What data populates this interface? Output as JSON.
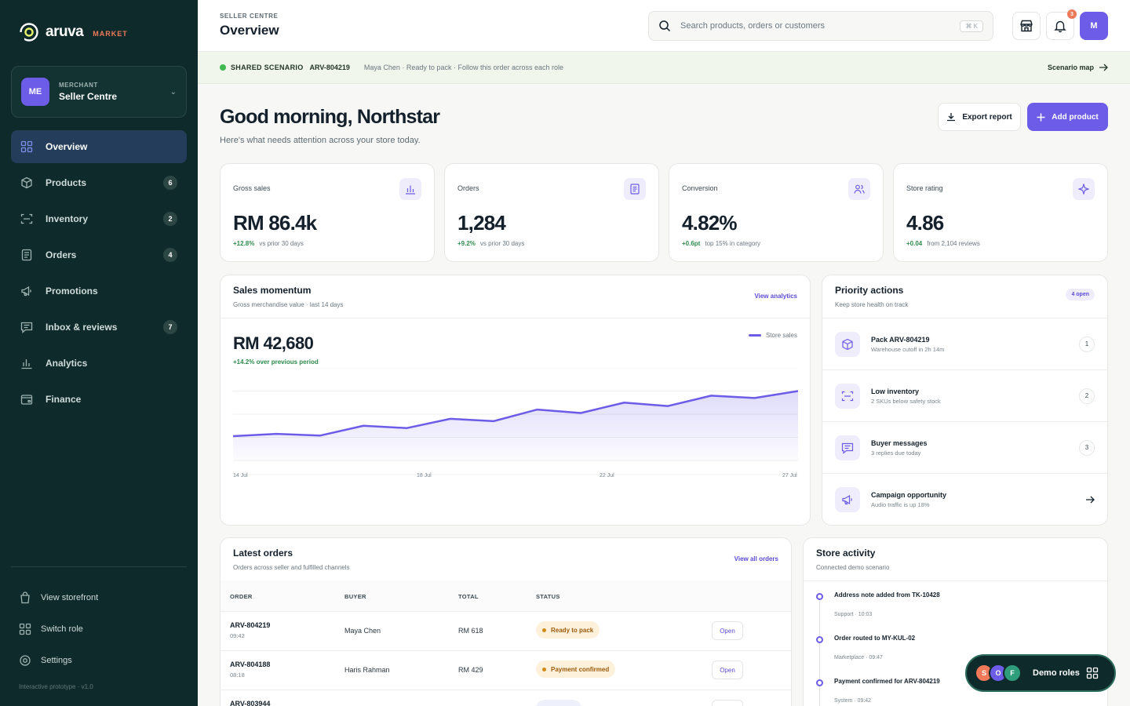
{
  "brand": {
    "name": "aruva",
    "sub": "MARKET",
    "accent": "#6c5ce7",
    "sidebar_bg": "#0e2a2a"
  },
  "merchant": {
    "initials": "ME",
    "kicker": "MERCHANT",
    "name": "Seller Centre"
  },
  "nav": [
    {
      "label": "Overview",
      "icon": "grid-icon",
      "badge": ""
    },
    {
      "label": "Products",
      "icon": "box-icon",
      "badge": "6"
    },
    {
      "label": "Inventory",
      "icon": "scan-icon",
      "badge": "2"
    },
    {
      "label": "Orders",
      "icon": "document-icon",
      "badge": "4"
    },
    {
      "label": "Promotions",
      "icon": "megaphone-icon",
      "badge": ""
    },
    {
      "label": "Inbox & reviews",
      "icon": "chat-icon",
      "badge": "7"
    },
    {
      "label": "Analytics",
      "icon": "bar-chart-icon",
      "badge": ""
    },
    {
      "label": "Finance",
      "icon": "wallet-icon",
      "badge": ""
    }
  ],
  "footer_nav": [
    {
      "label": "View storefront",
      "icon": "bag-icon"
    },
    {
      "label": "Switch role",
      "icon": "grid-icon"
    },
    {
      "label": "Settings",
      "icon": "gear-icon"
    }
  ],
  "version": "Interactive prototype · v1.0",
  "header": {
    "kicker": "SELLER CENTRE",
    "title": "Overview",
    "search_placeholder": "Search products, orders or customers",
    "shortcut": "⌘ K",
    "notif_count": "3",
    "user_initial": "M"
  },
  "scenario": {
    "label": "SHARED SCENARIO",
    "id": "ARV-804219",
    "desc": "Maya Chen · Ready to pack · Follow this order across each role",
    "map_label": "Scenario map"
  },
  "greeting": {
    "title": "Good morning, Northstar",
    "subtitle": "Here's what needs attention across your store today.",
    "export_label": "Export report",
    "add_label": "Add product"
  },
  "kpis": [
    {
      "label": "Gross sales",
      "value": "RM 86.4k",
      "delta": "+12.8%",
      "note": "vs prior 30 days",
      "icon": "bar-chart-icon"
    },
    {
      "label": "Orders",
      "value": "1,284",
      "delta": "+9.2%",
      "note": "vs prior 30 days",
      "icon": "document-icon"
    },
    {
      "label": "Conversion",
      "value": "4.82%",
      "delta": "+0.6pt",
      "note": "top 15% in category",
      "icon": "users-icon"
    },
    {
      "label": "Store rating",
      "value": "4.86",
      "delta": "+0.04",
      "note": "from 2,104 reviews",
      "icon": "sparkle-icon"
    }
  ],
  "sales": {
    "title": "Sales momentum",
    "subtitle": "Gross merchandise value · last 14 days",
    "link": "View analytics",
    "value": "RM 42,680",
    "delta": "+14.2% over previous period",
    "legend": "Store sales"
  },
  "chart_data": {
    "type": "area",
    "series": [
      {
        "name": "Store sales",
        "values": [
          2.1,
          2.3,
          2.15,
          3.0,
          2.8,
          3.6,
          3.4,
          4.4,
          4.1,
          5.0,
          4.7,
          5.6,
          5.4,
          6.0
        ]
      }
    ],
    "x_ticks": [
      "14 Jul",
      "18 Jul",
      "22 Jul",
      "27 Jul"
    ],
    "ylim": [
      0,
      8
    ],
    "grid": true,
    "legend": "top-right"
  },
  "priority": {
    "title": "Priority actions",
    "subtitle": "Keep store health on track",
    "badge": "4 open",
    "items": [
      {
        "title": "Pack ARV-804219",
        "sub": "Warehouse cutoff in 2h 14m",
        "count": "1",
        "icon": "box-icon"
      },
      {
        "title": "Low inventory",
        "sub": "2 SKUs below safety stock",
        "count": "2",
        "icon": "scan-icon"
      },
      {
        "title": "Buyer messages",
        "sub": "3 replies due today",
        "count": "3",
        "icon": "chat-icon"
      },
      {
        "title": "Campaign opportunity",
        "sub": "Audio traffic is up 18%",
        "count": "",
        "icon": "megaphone-icon"
      }
    ]
  },
  "orders": {
    "title": "Latest orders",
    "subtitle": "Orders across seller and fulfilled channels",
    "link": "View all orders",
    "columns": [
      "ORDER",
      "BUYER",
      "TOTAL",
      "STATUS"
    ],
    "rows": [
      {
        "id": "ARV-804219",
        "time": "09:42",
        "buyer": "Maya Chen",
        "total": "RM 618",
        "status": "Ready to pack",
        "action": "Open"
      },
      {
        "id": "ARV-804188",
        "time": "08:18",
        "buyer": "Haris Rahman",
        "total": "RM 429",
        "status": "Payment confirmed",
        "action": "Open"
      },
      {
        "id": "ARV-803944",
        "time": "",
        "buyer": "",
        "total": "",
        "status": "",
        "action": ""
      }
    ]
  },
  "activity": {
    "title": "Store activity",
    "subtitle": "Connected demo scenario",
    "items": [
      {
        "title": "Address note added from TK-10428",
        "meta": "Support · 10:03"
      },
      {
        "title": "Order routed to MY-KUL-02",
        "meta": "Marketplace · 09:47"
      },
      {
        "title": "Payment confirmed for ARV-804219",
        "meta": "System · 09:42"
      }
    ]
  },
  "demo_roles": {
    "label": "Demo roles",
    "avatars": [
      {
        "letter": "S",
        "color": "#f0795a"
      },
      {
        "letter": "O",
        "color": "#6c5ce7"
      },
      {
        "letter": "F",
        "color": "#2f9c7a"
      }
    ]
  }
}
